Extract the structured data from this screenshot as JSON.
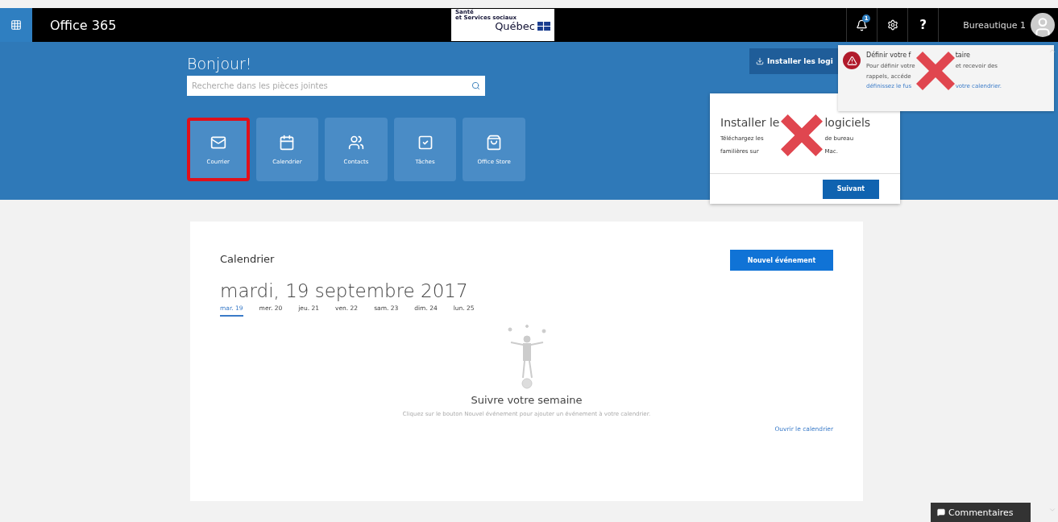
{
  "top_bar": {
    "title": "Office 365",
    "logo": {
      "line_1": "Santé",
      "line_2": "et Services sociaux",
      "name": "Québec"
    },
    "notification_badge": "1",
    "help": "?",
    "user": "Bureautique 1"
  },
  "hero": {
    "greeting": "Bonjour!",
    "search": {
      "placeholder": "Recherche dans les pièces jointes"
    },
    "tiles": [
      {
        "label": "Courrier",
        "highlighted": true
      },
      {
        "label": "Calendrier",
        "highlighted": false
      },
      {
        "label": "Contacts",
        "highlighted": false
      },
      {
        "label": "Tâches",
        "highlighted": false
      },
      {
        "label": "Office Store",
        "highlighted": false
      }
    ],
    "install_button": "Installer les logi"
  },
  "install_popup": {
    "title": [
      "Installer le",
      "logiciels"
    ],
    "body": [
      [
        "Téléchargez les",
        "de bureau"
      ],
      [
        "familières sur",
        "Mac."
      ]
    ],
    "next_button": "Suivant",
    "crossed_out": true
  },
  "notification": {
    "title": [
      "Définir votre f",
      "taire"
    ],
    "body": [
      [
        "Pour définir votre",
        "et recevoir des"
      ],
      [
        "rappels, accéde"
      ],
      [
        "définissez le fus",
        "votre calendrier."
      ]
    ],
    "crossed_out": true
  },
  "calendar": {
    "heading": "Calendrier",
    "new_button": "Nouvel événement",
    "date": "mardi, 19 septembre 2017",
    "days": [
      {
        "label": "mar. 19",
        "selected": true
      },
      {
        "label": "mer. 20",
        "selected": false
      },
      {
        "label": "jeu. 21",
        "selected": false
      },
      {
        "label": "ven. 22",
        "selected": false
      },
      {
        "label": "sam. 23",
        "selected": false
      },
      {
        "label": "dim. 24",
        "selected": false
      },
      {
        "label": "lun. 25",
        "selected": false
      }
    ],
    "empty_title": "Suivre votre semaine",
    "empty_text": "Cliquez sur le bouton Nouvel événement pour ajouter un événement à votre calendrier.",
    "open_link": "Ouvrir le calendrier"
  },
  "feedback_button": "Commentaires"
}
